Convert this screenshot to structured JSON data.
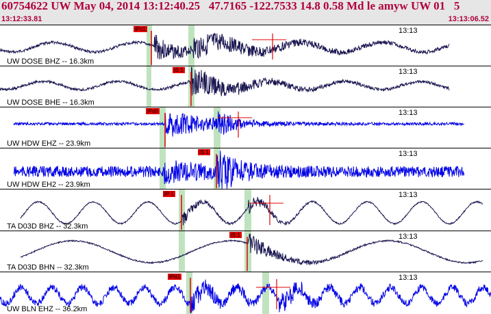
{
  "header": {
    "title": "60754622 UW May 04, 2014 13:12:40.25   47.7165 -122.7533 14.8 0.58 Md le amyw UW 01   5",
    "start_time": "13:12:33.81",
    "end_time": "13:13:06.52"
  },
  "colors": {
    "header_bg": "#e6e6e6",
    "header_text": "#b0003a",
    "trace_dark": "#1a1650",
    "trace_blue": "#0000e6",
    "pick_red": "#e00000",
    "window_green": "#bfe3bf"
  },
  "traces": [
    {
      "label": "UW DOSE BHZ -- 16.3km",
      "time_mark": "13:13",
      "color": "dark",
      "pick": "iPc1"
    },
    {
      "label": "UW DOSE BHE -- 16.3km",
      "time_mark": "13:13",
      "color": "dark",
      "pick": "iS 1"
    },
    {
      "label": "UW HDW EHZ -- 23.9km",
      "time_mark": "13:13",
      "color": "blue",
      "pick": "iPc0"
    },
    {
      "label": "UW HDW EH2 -- 23.9km",
      "time_mark": "13:13",
      "color": "blue",
      "pick": "iS 1"
    },
    {
      "label": "TA D03D BHZ -- 32.3km",
      "time_mark": "13:13",
      "color": "dark",
      "pick": "iP 1"
    },
    {
      "label": "TA D03D BHN -- 32.3km",
      "time_mark": "13:13",
      "color": "dark",
      "pick": "iS 1"
    },
    {
      "label": "UW BLN EHZ -- 36.2km",
      "time_mark": "13:13",
      "color": "blue",
      "pick": "iPd1"
    }
  ]
}
